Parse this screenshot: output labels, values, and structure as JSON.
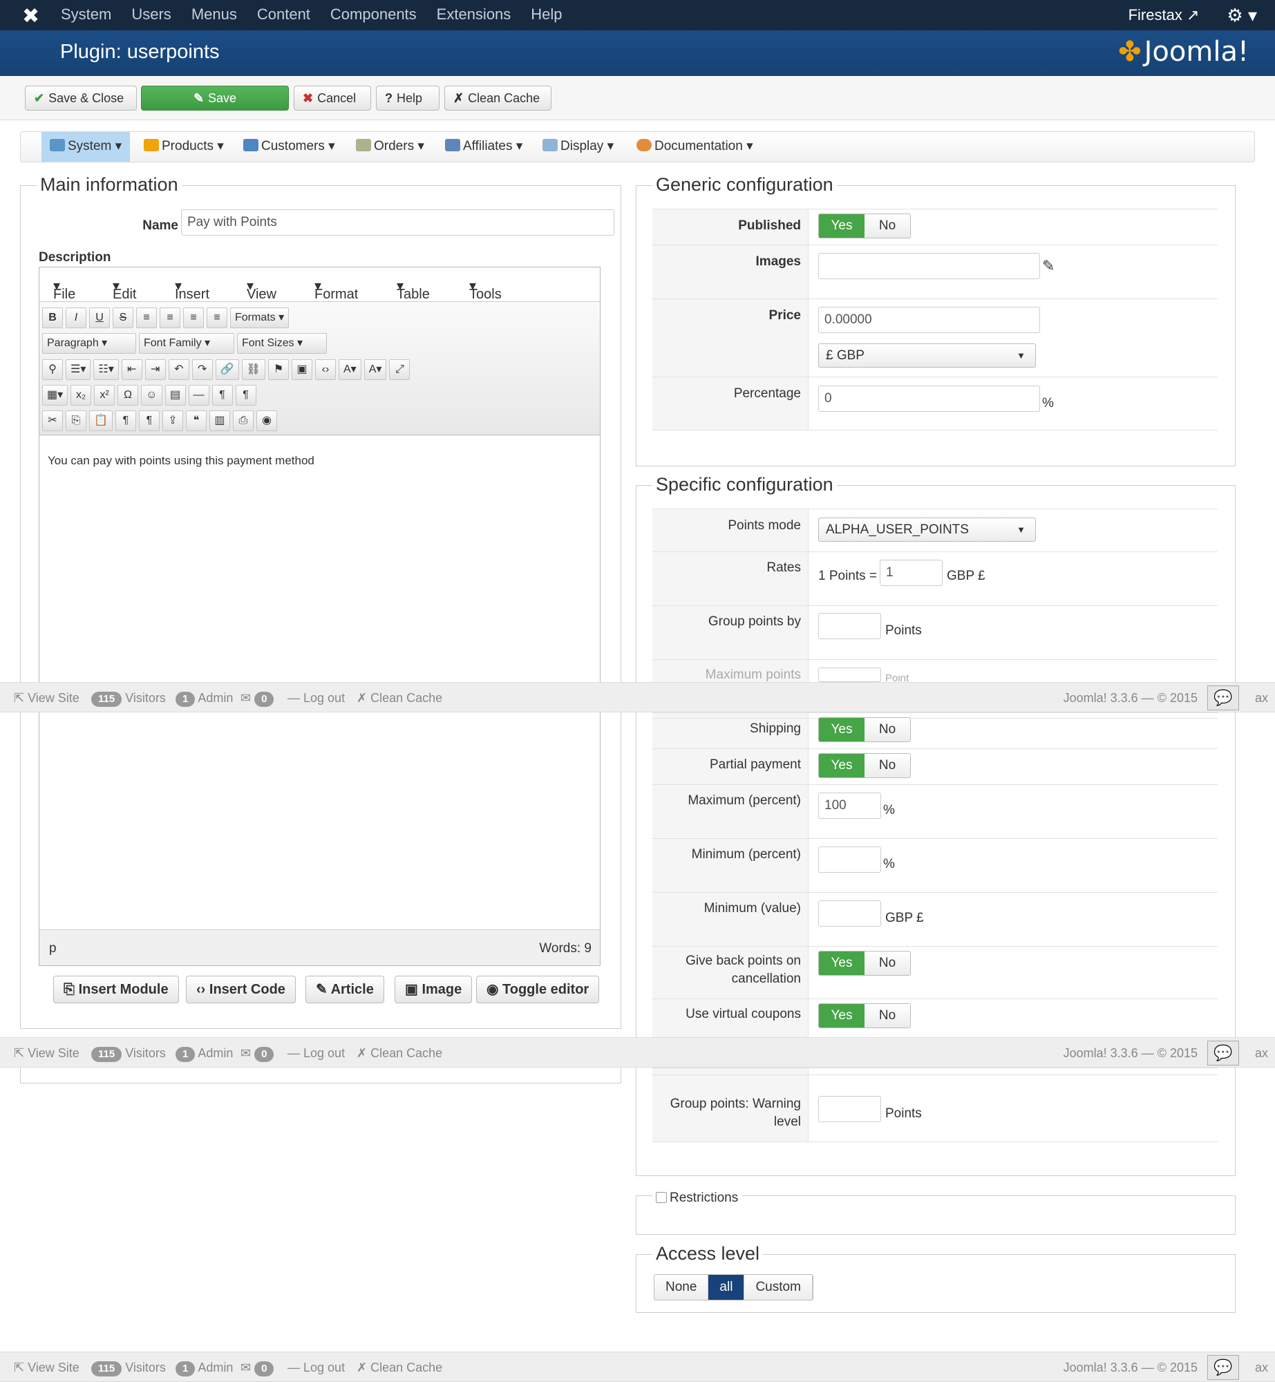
{
  "topbar": {
    "menu": [
      "System",
      "Users",
      "Menus",
      "Content",
      "Components",
      "Extensions",
      "Help"
    ],
    "site": "Firestax",
    "settings_icon": "gear-icon"
  },
  "title": "Plugin: userpoints",
  "brand": "Joomla!",
  "toolbar": {
    "save_close": "Save & Close",
    "save": "Save",
    "cancel": "Cancel",
    "help": "Help",
    "clean_cache": "Clean Cache"
  },
  "submenu": [
    "System",
    "Products",
    "Customers",
    "Orders",
    "Affiliates",
    "Display",
    "Documentation"
  ],
  "main": {
    "legend": "Main information",
    "name_label": "Name",
    "name_value": "Pay with Points",
    "description_label": "Description",
    "editor_menu": [
      "File",
      "Edit",
      "Insert",
      "View",
      "Format",
      "Table",
      "Tools"
    ],
    "formats": "Formats",
    "paragraph": "Paragraph",
    "font_family": "Font Family",
    "font_sizes": "Font Sizes",
    "content": "You can pay with points using this payment method",
    "path": "p",
    "words": "Words: 9",
    "buttons": [
      "Insert Module",
      "Insert Code",
      "Article",
      "Image",
      "Toggle editor"
    ]
  },
  "generic": {
    "legend": "Generic configuration",
    "published": "Published",
    "images": "Images",
    "price": "Price",
    "price_value": "0.00000",
    "currency": "£ GBP",
    "percentage": "Percentage",
    "percentage_value": "0",
    "pct": "%",
    "yes": "Yes",
    "no": "No"
  },
  "specific": {
    "legend": "Specific configuration",
    "points_mode": "Points mode",
    "points_mode_value": "ALPHA_USER_POINTS",
    "rates": "Rates",
    "rates_prefix": "1 Points =",
    "rates_value": "1",
    "gbp": "GBP £",
    "group_points_by": "Group points by",
    "points": "Points",
    "max_points": "Maximum points",
    "max_points_unit": "Point",
    "shipping": "Shipping",
    "partial_payment": "Partial payment",
    "max_percent": "Maximum (percent)",
    "max_percent_value": "100",
    "min_percent": "Minimum (percent)",
    "min_value": "Minimum (value)",
    "give_back_1": "Give back points on",
    "give_back_2": "cancellation",
    "virtual_coupons": "Use virtual coupons",
    "warning_1": "Group points: Warning",
    "warning_2": "level"
  },
  "restrictions": "Restrictions",
  "access": {
    "legend": "Access level",
    "options": [
      "None",
      "all",
      "Custom"
    ],
    "selected": "all"
  },
  "footer": {
    "view_site": "View Site",
    "visitors_count": "115",
    "visitors": "Visitors",
    "admin_count": "1",
    "admin": "Admin",
    "msg_count": "0",
    "logout": "Log out",
    "clean_cache": "Clean Cache",
    "version": "Joomla! 3.3.6  —  © 2015",
    "tail": "ax"
  }
}
